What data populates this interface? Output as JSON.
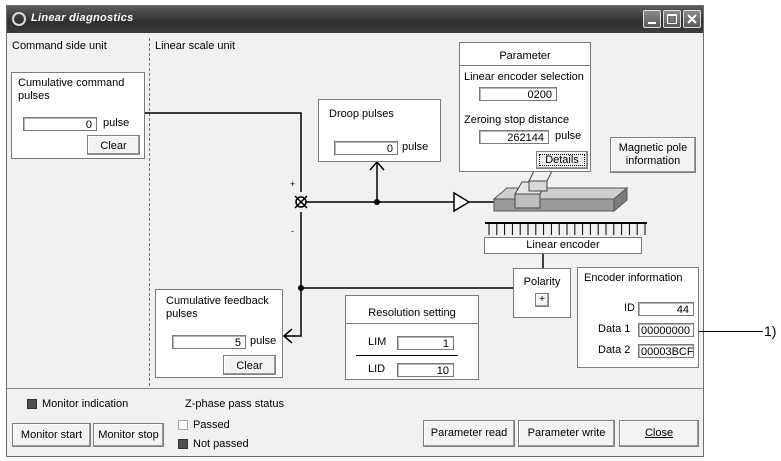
{
  "window": {
    "title": "Linear diagnostics"
  },
  "sections": {
    "command_side": "Command side unit",
    "linear_scale": "Linear scale unit"
  },
  "cumulative_command": {
    "title": "Cumulative command pulses",
    "value": "0",
    "unit": "pulse",
    "clear_label": "Clear"
  },
  "droop": {
    "title": "Droop pulses",
    "value": "0",
    "unit": "pulse"
  },
  "parameter": {
    "title": "Parameter",
    "encoder_selection_label": "Linear encoder selection",
    "encoder_selection_value": "0200",
    "zeroing_label": "Zeroing stop distance",
    "zeroing_value": "262144",
    "zeroing_unit": "pulse",
    "details_label": "Details"
  },
  "magnetic_pole_button": {
    "line1": "Magnetic pole",
    "line2": "information"
  },
  "linear_encoder_label": "Linear encoder",
  "polarity": {
    "label": "Polarity",
    "sign": "+"
  },
  "encoder_info": {
    "title": "Encoder information",
    "id_label": "ID",
    "id_value": "44",
    "data1_label": "Data 1",
    "data1_value": "00000000",
    "data2_label": "Data 2",
    "data2_value": "00003BCF"
  },
  "callout": "1)",
  "feedback": {
    "title": "Cumulative feedback pulses",
    "value": "5",
    "unit": "pulse",
    "clear_label": "Clear"
  },
  "resolution": {
    "title": "Resolution setting",
    "lim_label": "LIM",
    "lim_value": "1",
    "lid_label": "LID",
    "lid_value": "10"
  },
  "summing": {
    "plus": "+",
    "minus": "-"
  },
  "bottom": {
    "monitor_indication": "Monitor indication",
    "zphase_title": "Z-phase pass status",
    "passed": "Passed",
    "not_passed": "Not passed",
    "monitor_start": "Monitor start",
    "monitor_stop": "Monitor stop",
    "parameter_read": "Parameter read",
    "parameter_write": "Parameter write",
    "close": "Close"
  },
  "colors": {
    "monitor_square": "#505050",
    "not_passed_square": "#505050",
    "passed_square": "#ffffff"
  }
}
